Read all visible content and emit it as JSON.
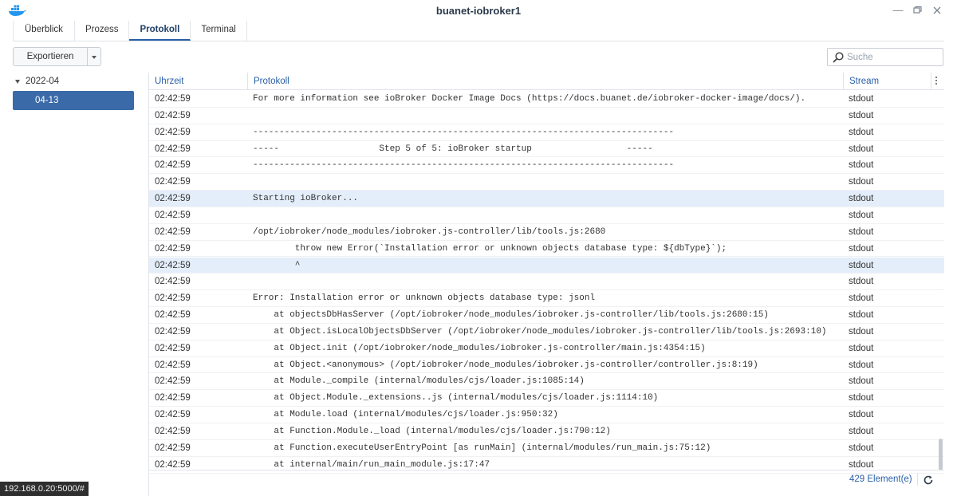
{
  "window": {
    "title": "buanet-iobroker1",
    "app_icon": "docker-whale-icon",
    "controls": [
      "minimize-icon",
      "maximize-icon",
      "close-icon"
    ]
  },
  "tabs": [
    {
      "label": "Überblick",
      "active": false
    },
    {
      "label": "Prozess",
      "active": false
    },
    {
      "label": "Protokoll",
      "active": true
    },
    {
      "label": "Terminal",
      "active": false
    }
  ],
  "toolbar": {
    "export_label": "Exportieren",
    "search_placeholder": "Suche"
  },
  "sidebar": {
    "group_label": "2022-04",
    "selected_item": "04-13"
  },
  "grid": {
    "columns": [
      "Uhrzeit",
      "Protokoll",
      "Stream"
    ],
    "rows": [
      {
        "time": "02:42:59",
        "message": "For more information see ioBroker Docker Image Docs (https://docs.buanet.de/iobroker-docker-image/docs/).",
        "stream": "stdout",
        "highlight": false
      },
      {
        "time": "02:42:59",
        "message": "",
        "stream": "stdout",
        "highlight": false
      },
      {
        "time": "02:42:59",
        "message": "--------------------------------------------------------------------------------",
        "stream": "stdout",
        "highlight": false
      },
      {
        "time": "02:42:59",
        "message": "-----                   Step 5 of 5: ioBroker startup                  -----",
        "stream": "stdout",
        "highlight": false
      },
      {
        "time": "02:42:59",
        "message": "--------------------------------------------------------------------------------",
        "stream": "stdout",
        "highlight": false
      },
      {
        "time": "02:42:59",
        "message": "",
        "stream": "stdout",
        "highlight": false
      },
      {
        "time": "02:42:59",
        "message": "Starting ioBroker...",
        "stream": "stdout",
        "highlight": true
      },
      {
        "time": "02:42:59",
        "message": "",
        "stream": "stdout",
        "highlight": false
      },
      {
        "time": "02:42:59",
        "message": "/opt/iobroker/node_modules/iobroker.js-controller/lib/tools.js:2680",
        "stream": "stdout",
        "highlight": false
      },
      {
        "time": "02:42:59",
        "message": "        throw new Error(`Installation error or unknown objects database type: ${dbType}`);",
        "stream": "stdout",
        "highlight": false
      },
      {
        "time": "02:42:59",
        "message": "        ^",
        "stream": "stdout",
        "highlight": true
      },
      {
        "time": "02:42:59",
        "message": "",
        "stream": "stdout",
        "highlight": false
      },
      {
        "time": "02:42:59",
        "message": "Error: Installation error or unknown objects database type: jsonl",
        "stream": "stdout",
        "highlight": false
      },
      {
        "time": "02:42:59",
        "message": "    at objectsDbHasServer (/opt/iobroker/node_modules/iobroker.js-controller/lib/tools.js:2680:15)",
        "stream": "stdout",
        "highlight": false
      },
      {
        "time": "02:42:59",
        "message": "    at Object.isLocalObjectsDbServer (/opt/iobroker/node_modules/iobroker.js-controller/lib/tools.js:2693:10)",
        "stream": "stdout",
        "highlight": false
      },
      {
        "time": "02:42:59",
        "message": "    at Object.init (/opt/iobroker/node_modules/iobroker.js-controller/main.js:4354:15)",
        "stream": "stdout",
        "highlight": false
      },
      {
        "time": "02:42:59",
        "message": "    at Object.<anonymous> (/opt/iobroker/node_modules/iobroker.js-controller/controller.js:8:19)",
        "stream": "stdout",
        "highlight": false
      },
      {
        "time": "02:42:59",
        "message": "    at Module._compile (internal/modules/cjs/loader.js:1085:14)",
        "stream": "stdout",
        "highlight": false
      },
      {
        "time": "02:42:59",
        "message": "    at Object.Module._extensions..js (internal/modules/cjs/loader.js:1114:10)",
        "stream": "stdout",
        "highlight": false
      },
      {
        "time": "02:42:59",
        "message": "    at Module.load (internal/modules/cjs/loader.js:950:32)",
        "stream": "stdout",
        "highlight": false
      },
      {
        "time": "02:42:59",
        "message": "    at Function.Module._load (internal/modules/cjs/loader.js:790:12)",
        "stream": "stdout",
        "highlight": false
      },
      {
        "time": "02:42:59",
        "message": "    at Function.executeUserEntryPoint [as runMain] (internal/modules/run_main.js:75:12)",
        "stream": "stdout",
        "highlight": false
      },
      {
        "time": "02:42:59",
        "message": "    at internal/main/run_main_module.js:17:47",
        "stream": "stdout",
        "highlight": false
      }
    ]
  },
  "footer": {
    "count_label": "429 Element(e)"
  },
  "statusbar": {
    "url": "192.168.0.20:5000/#"
  },
  "colors": {
    "accent": "#2a5fa7",
    "selected_bg": "#3a6aa8",
    "row_highlight": "#e4eefa",
    "title": "#2b3a4a"
  }
}
